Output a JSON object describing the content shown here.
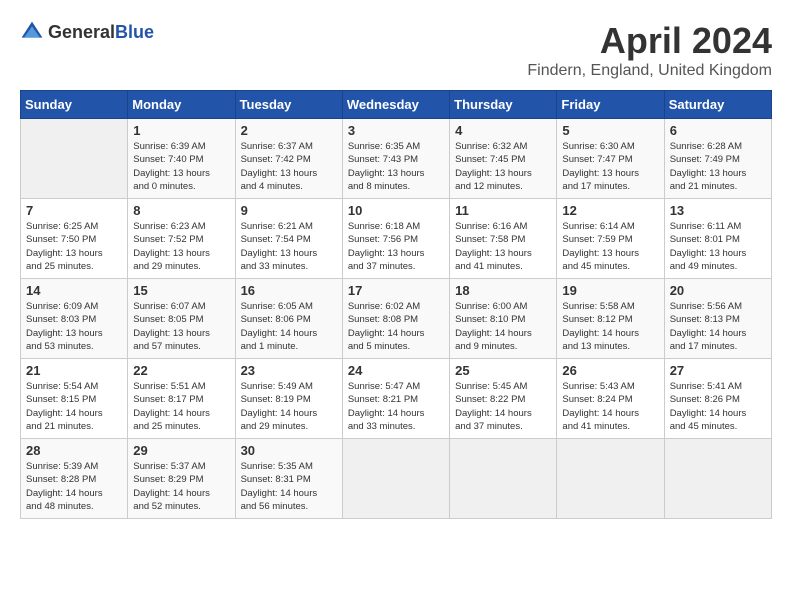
{
  "header": {
    "logo_general": "General",
    "logo_blue": "Blue",
    "month_title": "April 2024",
    "location": "Findern, England, United Kingdom"
  },
  "calendar": {
    "weekdays": [
      "Sunday",
      "Monday",
      "Tuesday",
      "Wednesday",
      "Thursday",
      "Friday",
      "Saturday"
    ],
    "weeks": [
      [
        {
          "day": null,
          "info": null
        },
        {
          "day": "1",
          "info": "Sunrise: 6:39 AM\nSunset: 7:40 PM\nDaylight: 13 hours\nand 0 minutes."
        },
        {
          "day": "2",
          "info": "Sunrise: 6:37 AM\nSunset: 7:42 PM\nDaylight: 13 hours\nand 4 minutes."
        },
        {
          "day": "3",
          "info": "Sunrise: 6:35 AM\nSunset: 7:43 PM\nDaylight: 13 hours\nand 8 minutes."
        },
        {
          "day": "4",
          "info": "Sunrise: 6:32 AM\nSunset: 7:45 PM\nDaylight: 13 hours\nand 12 minutes."
        },
        {
          "day": "5",
          "info": "Sunrise: 6:30 AM\nSunset: 7:47 PM\nDaylight: 13 hours\nand 17 minutes."
        },
        {
          "day": "6",
          "info": "Sunrise: 6:28 AM\nSunset: 7:49 PM\nDaylight: 13 hours\nand 21 minutes."
        }
      ],
      [
        {
          "day": "7",
          "info": "Sunrise: 6:25 AM\nSunset: 7:50 PM\nDaylight: 13 hours\nand 25 minutes."
        },
        {
          "day": "8",
          "info": "Sunrise: 6:23 AM\nSunset: 7:52 PM\nDaylight: 13 hours\nand 29 minutes."
        },
        {
          "day": "9",
          "info": "Sunrise: 6:21 AM\nSunset: 7:54 PM\nDaylight: 13 hours\nand 33 minutes."
        },
        {
          "day": "10",
          "info": "Sunrise: 6:18 AM\nSunset: 7:56 PM\nDaylight: 13 hours\nand 37 minutes."
        },
        {
          "day": "11",
          "info": "Sunrise: 6:16 AM\nSunset: 7:58 PM\nDaylight: 13 hours\nand 41 minutes."
        },
        {
          "day": "12",
          "info": "Sunrise: 6:14 AM\nSunset: 7:59 PM\nDaylight: 13 hours\nand 45 minutes."
        },
        {
          "day": "13",
          "info": "Sunrise: 6:11 AM\nSunset: 8:01 PM\nDaylight: 13 hours\nand 49 minutes."
        }
      ],
      [
        {
          "day": "14",
          "info": "Sunrise: 6:09 AM\nSunset: 8:03 PM\nDaylight: 13 hours\nand 53 minutes."
        },
        {
          "day": "15",
          "info": "Sunrise: 6:07 AM\nSunset: 8:05 PM\nDaylight: 13 hours\nand 57 minutes."
        },
        {
          "day": "16",
          "info": "Sunrise: 6:05 AM\nSunset: 8:06 PM\nDaylight: 14 hours\nand 1 minute."
        },
        {
          "day": "17",
          "info": "Sunrise: 6:02 AM\nSunset: 8:08 PM\nDaylight: 14 hours\nand 5 minutes."
        },
        {
          "day": "18",
          "info": "Sunrise: 6:00 AM\nSunset: 8:10 PM\nDaylight: 14 hours\nand 9 minutes."
        },
        {
          "day": "19",
          "info": "Sunrise: 5:58 AM\nSunset: 8:12 PM\nDaylight: 14 hours\nand 13 minutes."
        },
        {
          "day": "20",
          "info": "Sunrise: 5:56 AM\nSunset: 8:13 PM\nDaylight: 14 hours\nand 17 minutes."
        }
      ],
      [
        {
          "day": "21",
          "info": "Sunrise: 5:54 AM\nSunset: 8:15 PM\nDaylight: 14 hours\nand 21 minutes."
        },
        {
          "day": "22",
          "info": "Sunrise: 5:51 AM\nSunset: 8:17 PM\nDaylight: 14 hours\nand 25 minutes."
        },
        {
          "day": "23",
          "info": "Sunrise: 5:49 AM\nSunset: 8:19 PM\nDaylight: 14 hours\nand 29 minutes."
        },
        {
          "day": "24",
          "info": "Sunrise: 5:47 AM\nSunset: 8:21 PM\nDaylight: 14 hours\nand 33 minutes."
        },
        {
          "day": "25",
          "info": "Sunrise: 5:45 AM\nSunset: 8:22 PM\nDaylight: 14 hours\nand 37 minutes."
        },
        {
          "day": "26",
          "info": "Sunrise: 5:43 AM\nSunset: 8:24 PM\nDaylight: 14 hours\nand 41 minutes."
        },
        {
          "day": "27",
          "info": "Sunrise: 5:41 AM\nSunset: 8:26 PM\nDaylight: 14 hours\nand 45 minutes."
        }
      ],
      [
        {
          "day": "28",
          "info": "Sunrise: 5:39 AM\nSunset: 8:28 PM\nDaylight: 14 hours\nand 48 minutes."
        },
        {
          "day": "29",
          "info": "Sunrise: 5:37 AM\nSunset: 8:29 PM\nDaylight: 14 hours\nand 52 minutes."
        },
        {
          "day": "30",
          "info": "Sunrise: 5:35 AM\nSunset: 8:31 PM\nDaylight: 14 hours\nand 56 minutes."
        },
        {
          "day": null,
          "info": null
        },
        {
          "day": null,
          "info": null
        },
        {
          "day": null,
          "info": null
        },
        {
          "day": null,
          "info": null
        }
      ]
    ]
  }
}
